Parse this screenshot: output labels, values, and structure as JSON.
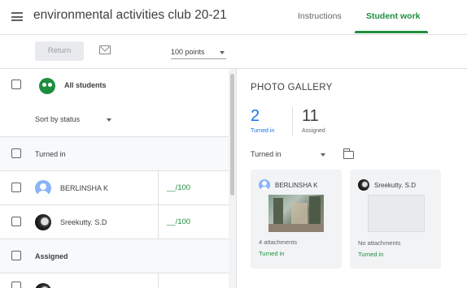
{
  "header": {
    "title": "environmental activities club 20-21",
    "tabs": [
      {
        "label": "Instructions"
      },
      {
        "label": "Student work"
      }
    ]
  },
  "toolbar": {
    "return_label": "Return",
    "points_label": "100 points"
  },
  "list": {
    "all_students_label": "All students",
    "sort_label": "Sort by status",
    "groups": [
      {
        "label": "Turned in",
        "students": [
          {
            "name": "BERLINSHA K",
            "grade": "__/100"
          },
          {
            "name": "Sreekutty. S.D",
            "grade": "__/100"
          }
        ]
      },
      {
        "label": "Assigned",
        "students": []
      }
    ]
  },
  "gallery": {
    "title": "PHOTO GALLERY",
    "stats": [
      {
        "value": "2",
        "label": "Turned in",
        "color": "#1a73e8"
      },
      {
        "value": "11",
        "label": "Assigned"
      }
    ],
    "filter_label": "Turned in",
    "cards": [
      {
        "name": "BERLINSHA K",
        "attachments": "4 attachments",
        "status": "Turned in"
      },
      {
        "name": "Sreekutty. S.D",
        "attachments": "No attachments",
        "status": "Turned in"
      }
    ]
  },
  "colors": {
    "accent_green": "#1e8e3e",
    "accent_blue": "#1a73e8"
  }
}
